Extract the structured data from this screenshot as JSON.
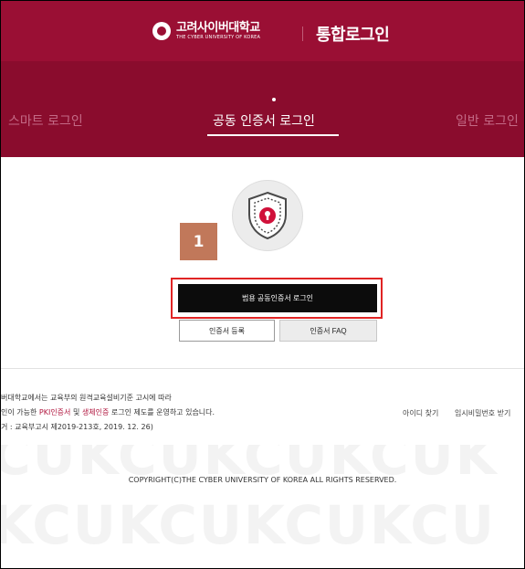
{
  "header": {
    "logo_ko": "고려사이버대학교",
    "logo_en": "THE CYBER UNIVERSITY OF KOREA",
    "title": "통합로그인"
  },
  "tabs": [
    {
      "label": "스마트 로그인",
      "active": false
    },
    {
      "label": "공동 인증서 로그인",
      "active": true
    },
    {
      "label": "일반 로그인",
      "active": false
    }
  ],
  "cert": {
    "badge": "1",
    "primary_button": "범용 공동인증서 로그인",
    "register_button": "인증서 등록",
    "faq_button": "인증서 FAQ"
  },
  "notice": {
    "line1": "버대학교에서는 교육부의 원격교육설비기준 고시에 따라",
    "line2_prefix": "인이 가능한 ",
    "line2_pki": "PKI인증서",
    "line2_mid": " 및 ",
    "line2_bio": "생체인증",
    "line2_suffix": " 로그인 제도를 운영하고 있습니다.",
    "line3": "거 : 교육부고시 제2019-213호, 2019. 12. 26)"
  },
  "links": {
    "find_id": "아이디 찾기",
    "temp_password": "임시비밀번호 받기"
  },
  "footer": {
    "copyright": "COPYRIGHT(C)THE CYBER UNIVERSITY OF KOREA ALL RIGHTS RESERVED.",
    "watermark1": "CUKCUKCUKCUK",
    "watermark2": "KCUKCUKCUKCU"
  },
  "colors": {
    "brand": "#9a0f34",
    "tab_band": "#8a0c2d",
    "highlight_red": "#e02424",
    "badge": "#c1785a"
  }
}
